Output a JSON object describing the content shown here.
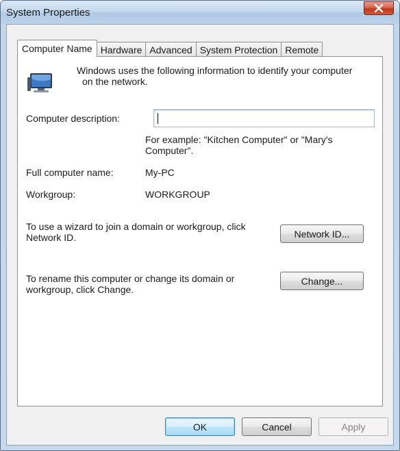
{
  "window": {
    "title": "System Properties",
    "close_label": "✕"
  },
  "tabs": [
    {
      "label": "Computer Name",
      "active": true
    },
    {
      "label": "Hardware",
      "active": false
    },
    {
      "label": "Advanced",
      "active": false
    },
    {
      "label": "System Protection",
      "active": false
    },
    {
      "label": "Remote",
      "active": false
    }
  ],
  "computer_name": {
    "intro_line1": "Windows uses the following information to identify your computer",
    "intro_line2": "on the network.",
    "description_label": "Computer description:",
    "description_value": "",
    "example_line1": "For example: \"Kitchen Computer\" or \"Mary's",
    "example_line2": "Computer\".",
    "full_name_label": "Full computer name:",
    "full_name_value": "My-PC",
    "workgroup_label": "Workgroup:",
    "workgroup_value": "WORKGROUP",
    "network_id_text_line1": "To use a wizard to join a domain or workgroup, click",
    "network_id_text_line2": "Network ID.",
    "network_id_button": "Network ID...",
    "change_text_line1": "To rename this computer or change its domain or",
    "change_text_line2": "workgroup, click Change.",
    "change_button": "Change..."
  },
  "footer": {
    "ok": "OK",
    "cancel": "Cancel",
    "apply": "Apply"
  },
  "icons": {
    "computer": "computer-icon",
    "close": "close-icon"
  },
  "colors": {
    "title_bar": "#c2d6ec",
    "close_button": "#c1371c",
    "ok_button_border": "#3c7fb1",
    "panel_bg": "#ffffff",
    "dialog_bg": "#f0f0f0"
  }
}
